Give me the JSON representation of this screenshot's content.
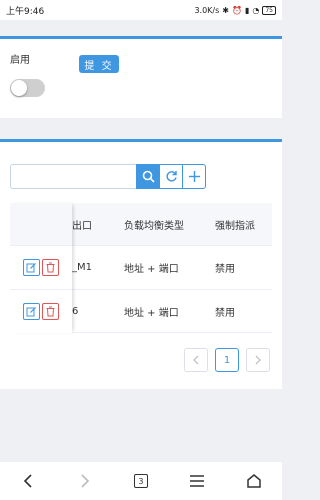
{
  "status_bar": {
    "time": "上午9:46",
    "net_speed": "3.0K/s",
    "battery": "75"
  },
  "form_card": {
    "enable_label": "启用",
    "enabled": false,
    "submit_label": "提 交"
  },
  "list_card": {
    "search": {
      "value": "",
      "placeholder": ""
    },
    "columns": {
      "actions": "",
      "port": "出口",
      "lb_type": "负载均衡类型",
      "force": "强制指派"
    },
    "rows": [
      {
        "port": "_M1",
        "lb_type": "地址 + 端口",
        "force": "禁用"
      },
      {
        "port": "6",
        "lb_type": "地址 + 端口",
        "force": "禁用"
      }
    ],
    "pagination": {
      "current_page": "1"
    }
  },
  "nav_bar": {
    "tab_count": "3"
  },
  "colors": {
    "accent": "#3e97e0",
    "danger": "#e05656",
    "background": "#eef0f4"
  }
}
